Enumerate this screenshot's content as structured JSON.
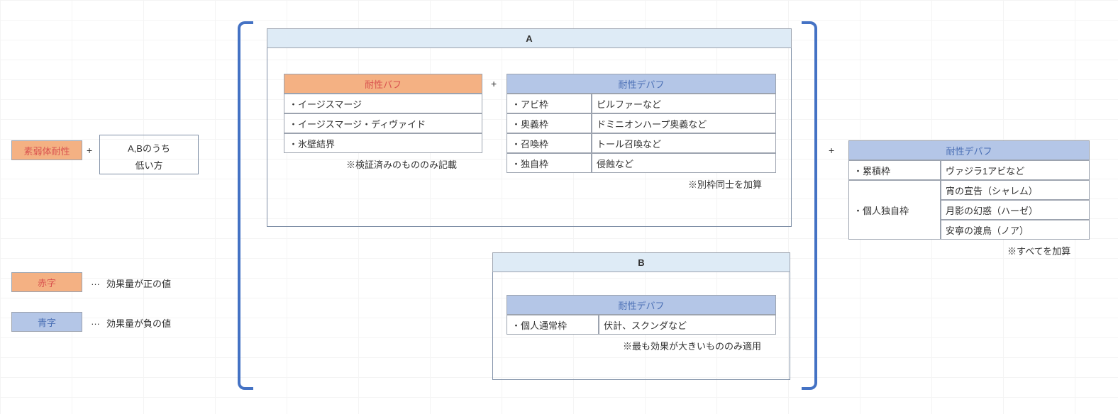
{
  "left": {
    "base": "素弱体耐性",
    "minAB_line1": "A,Bのうち",
    "minAB_line2": "低い方"
  },
  "legend": {
    "red_label": "赤字",
    "red_desc": "効果量が正の値",
    "blue_label": "青字",
    "blue_desc": "効果量が負の値",
    "dots": "…"
  },
  "plus": "+",
  "boxA": {
    "title": "A",
    "buff": {
      "header": "耐性バフ",
      "rows": [
        "・イージスマージ",
        "・イージスマージ・ディヴァイド",
        "・氷壁結界"
      ],
      "note": "※検証済みのもののみ記載"
    },
    "debuff": {
      "header": "耐性デバフ",
      "rows": [
        {
          "l": "・アビ枠",
          "r": "ピルファーなど"
        },
        {
          "l": "・奥義枠",
          "r": "ドミニオンハープ奥義など"
        },
        {
          "l": "・召喚枠",
          "r": "トール召喚など"
        },
        {
          "l": "・独自枠",
          "r": "侵蝕など"
        }
      ],
      "note": "※別枠同士を加算"
    }
  },
  "boxB": {
    "title": "B",
    "debuff": {
      "header": "耐性デバフ",
      "row": {
        "l": "・個人通常枠",
        "r": "伏計、スクンダなど"
      },
      "note": "※最も効果が大きいもののみ適用"
    }
  },
  "right": {
    "header": "耐性デバフ",
    "rows": [
      {
        "l": "・累積枠",
        "r": "ヴァジラ1アビなど"
      },
      {
        "l": "",
        "r": "宵の宣告（シャレム）"
      },
      {
        "l": "・個人独自枠",
        "r": "月影の幻惑（ハーゼ）"
      },
      {
        "l": "",
        "r": "安寧の渡鳥（ノア）"
      }
    ],
    "note": "※すべてを加算"
  }
}
